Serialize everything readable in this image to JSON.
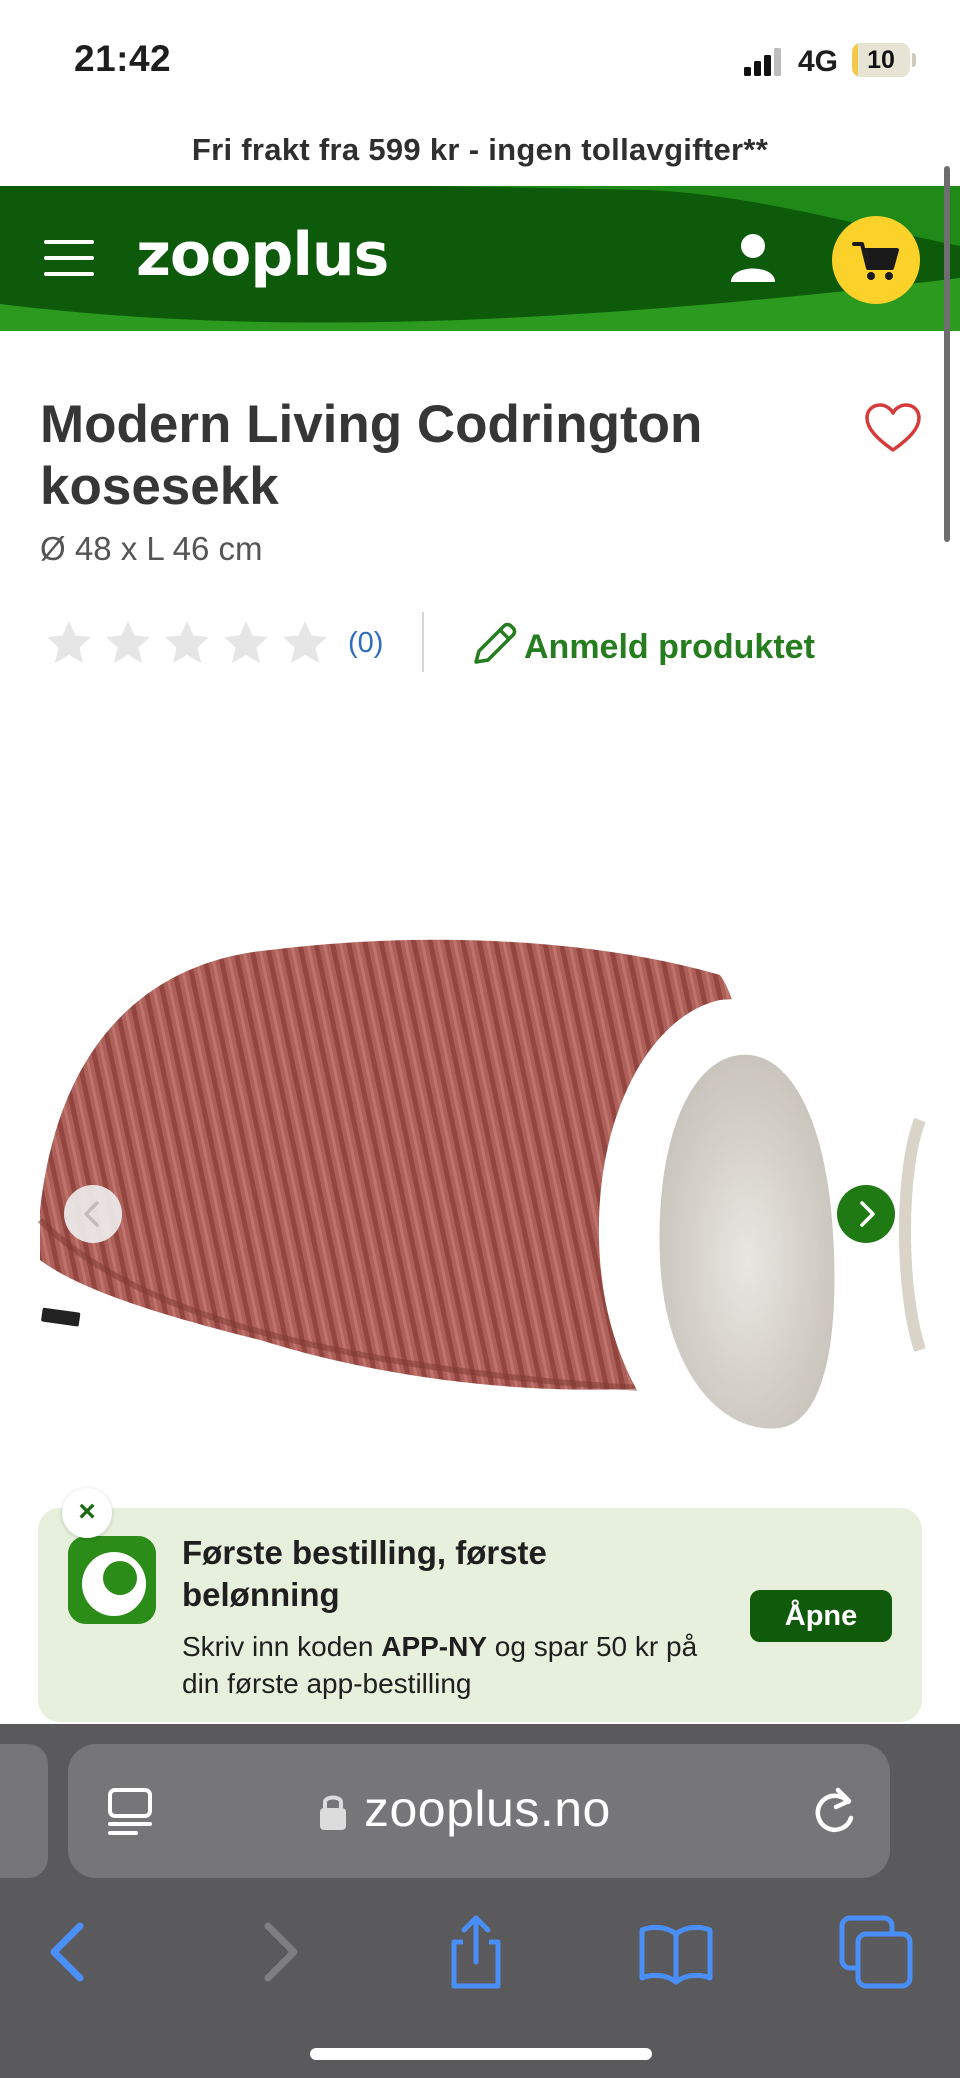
{
  "status_bar": {
    "time": "21:42",
    "network": "4G",
    "battery": "10",
    "battery_level": 0.1
  },
  "promo": {
    "text": "Fri frakt fra 599 kr - ingen tollavgifter**"
  },
  "header": {
    "logo": "zooplus",
    "icons": [
      "menu-icon",
      "account-icon",
      "cart-icon"
    ]
  },
  "product": {
    "title": "Modern Living Codrington kosesekk",
    "size": "Ø 48 x L 46 cm",
    "rating_count": "(0)",
    "rating_value": 0,
    "review_label": "Anmeld produktet"
  },
  "banner": {
    "close": "×",
    "title": "Første bestilling, første belønning",
    "subtitle_pre": "Skriv inn koden ",
    "code": "APP-NY",
    "subtitle_post": " og spar 50 kr på din første app-bestilling",
    "button": "Åpne"
  },
  "browser": {
    "url": "zooplus.no",
    "toolbar": [
      "back-icon",
      "forward-icon",
      "share-icon",
      "bookmarks-icon",
      "tabs-icon"
    ]
  },
  "colors": {
    "brand_green": "#0d5a0b",
    "accent_green": "#267d1f",
    "cart_yellow": "#fcd12a",
    "banner_bg": "#e6f0dc",
    "safari_bar": "#5a5a5c",
    "ios_blue": "#4a8ff7"
  }
}
